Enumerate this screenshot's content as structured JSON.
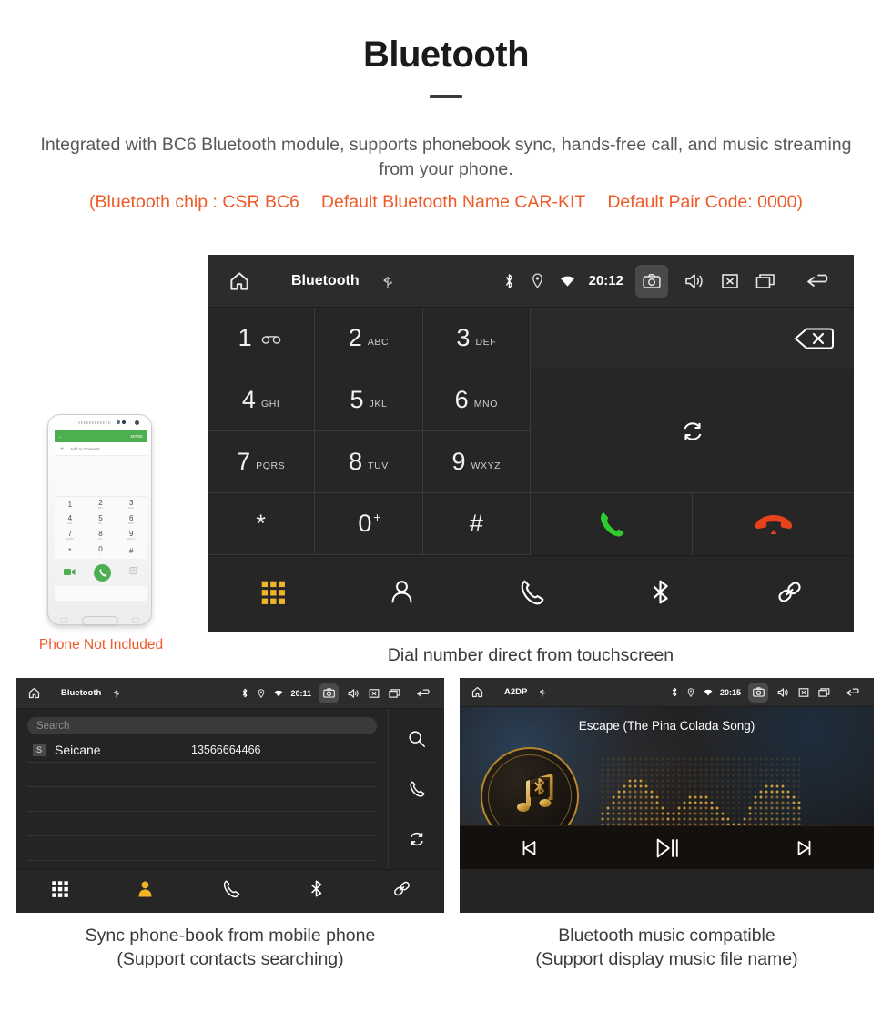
{
  "header": {
    "title": "Bluetooth",
    "intro": "Integrated with BC6 Bluetooth module, supports phonebook sync, hands-free call, and music streaming from your phone.",
    "spec_chip": "(Bluetooth chip : CSR BC6",
    "spec_name": "Default Bluetooth Name CAR-KIT",
    "spec_pair": "Default Pair Code: 0000)",
    "accent_color": "#f05a28",
    "body_color": "#58585a"
  },
  "dialer_screen": {
    "status_bar": {
      "home_icon": "home-icon",
      "title": "Bluetooth",
      "usb_icon": "usb-icon",
      "bluetooth_icon": "bluetooth-icon",
      "location_icon": "location-icon",
      "wifi_icon": "wifi-icon",
      "time": "20:12",
      "camera_icon": "camera-icon",
      "volume_icon": "volume-icon",
      "close_icon": "close-box-icon",
      "recents_icon": "recent-apps-icon",
      "back_icon": "back-arrow-icon"
    },
    "keys": [
      {
        "num": "1",
        "sub": "",
        "sub_icon": "voicemail-icon"
      },
      {
        "num": "2",
        "sub": "ABC",
        "sub_icon": ""
      },
      {
        "num": "3",
        "sub": "DEF",
        "sub_icon": ""
      },
      {
        "num": "4",
        "sub": "GHI",
        "sub_icon": ""
      },
      {
        "num": "5",
        "sub": "JKL",
        "sub_icon": ""
      },
      {
        "num": "6",
        "sub": "MNO",
        "sub_icon": ""
      },
      {
        "num": "7",
        "sub": "PQRS",
        "sub_icon": ""
      },
      {
        "num": "8",
        "sub": "TUV",
        "sub_icon": ""
      },
      {
        "num": "9",
        "sub": "WXYZ",
        "sub_icon": ""
      },
      {
        "num": "*",
        "sub": "",
        "sub_icon": ""
      },
      {
        "num": "0",
        "sub": "",
        "sub_icon": "plus-sign"
      },
      {
        "num": "#",
        "sub": "",
        "sub_icon": ""
      }
    ],
    "number_input": "",
    "backspace_icon": "backspace-icon",
    "sync_icon": "sync-icon",
    "call_icon": "call-green-icon",
    "hangup_icon": "hangup-red-icon",
    "call_color": "#2ecc2e",
    "hangup_color": "#e8421c",
    "nav": [
      {
        "name": "dialpad",
        "icon": "dialpad-icon",
        "active": true
      },
      {
        "name": "contacts",
        "icon": "person-icon",
        "active": false
      },
      {
        "name": "call-log",
        "icon": "handset-icon",
        "active": false
      },
      {
        "name": "bluetooth",
        "icon": "bluetooth-icon",
        "active": false
      },
      {
        "name": "link",
        "icon": "link-icon",
        "active": false
      }
    ],
    "active_color": "#f0b429",
    "caption": "Dial number direct from touchscreen"
  },
  "phone_mockup": {
    "header_back_icon": "back-arrow-icon",
    "header_more": "MORE",
    "add_contact_label": "Add to Contacts",
    "keys": [
      {
        "num": "1",
        "sub": ""
      },
      {
        "num": "2",
        "sub": "ABC"
      },
      {
        "num": "3",
        "sub": "DEF"
      },
      {
        "num": "4",
        "sub": "GHI"
      },
      {
        "num": "5",
        "sub": "JKL"
      },
      {
        "num": "6",
        "sub": "MNO"
      },
      {
        "num": "7",
        "sub": "PQRS"
      },
      {
        "num": "8",
        "sub": "TUV"
      },
      {
        "num": "9",
        "sub": "WXYZ"
      },
      {
        "num": "*",
        "sub": ""
      },
      {
        "num": "0",
        "sub": "+"
      },
      {
        "num": "#",
        "sub": ""
      }
    ],
    "video_icon": "video-call-icon",
    "call_icon": "call-icon",
    "keyboard_icon": "keyboard-icon",
    "note": "Phone Not Included"
  },
  "phonebook_screen": {
    "status_bar": {
      "home_icon": "home-icon",
      "title": "Bluetooth",
      "usb_icon": "usb-icon",
      "time": "20:11"
    },
    "search_placeholder": "Search",
    "contacts": [
      {
        "initial": "S",
        "name": "Seicane",
        "number": "13566664466"
      }
    ],
    "empty_rows": 4,
    "side_tools": [
      {
        "name": "search",
        "icon": "search-icon"
      },
      {
        "name": "call",
        "icon": "handset-icon"
      },
      {
        "name": "sync",
        "icon": "sync-icon"
      }
    ],
    "nav": [
      {
        "name": "dialpad",
        "icon": "dialpad-icon",
        "active": false
      },
      {
        "name": "contacts",
        "icon": "person-filled-icon",
        "active": true
      },
      {
        "name": "call-log",
        "icon": "handset-icon",
        "active": false
      },
      {
        "name": "bluetooth",
        "icon": "bluetooth-icon",
        "active": false
      },
      {
        "name": "link",
        "icon": "link-icon",
        "active": false
      }
    ],
    "caption_line1": "Sync phone-book from mobile phone",
    "caption_line2": "(Support contacts searching)"
  },
  "music_screen": {
    "status_bar": {
      "home_icon": "home-icon",
      "title": "A2DP",
      "usb_icon": "usb-icon",
      "time": "20:15"
    },
    "song_title": "Escape (The Pina Colada Song)",
    "album_art_icon": "music-note-bluetooth-icon",
    "visualizer": "dot-matrix-spectrum",
    "controls": [
      {
        "name": "previous",
        "icon": "skip-previous-icon"
      },
      {
        "name": "play-pause",
        "icon": "play-pause-icon"
      },
      {
        "name": "next",
        "icon": "skip-next-icon"
      }
    ],
    "accent_gold": "#d4a03e",
    "caption_line1": "Bluetooth music compatible",
    "caption_line2": "(Support display music file name)"
  }
}
